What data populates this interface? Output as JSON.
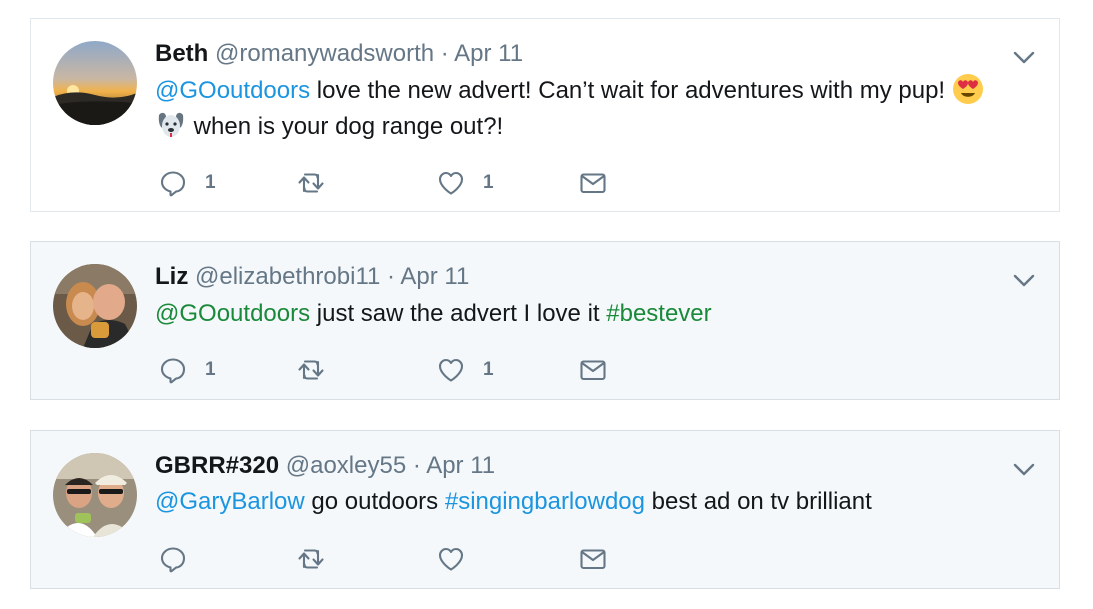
{
  "tweets": [
    {
      "name": "Beth",
      "handle": "@romanywadsworth",
      "dot": "·",
      "date": "Apr 11",
      "line1": {
        "mention": "@GOoutdoors",
        "text": " love the new advert! Can’t wait for adventures with my pup! "
      },
      "line2": {
        "text": " when is your dog range out?!"
      },
      "emojis": [
        "heart-eyes-emoji",
        "dog-face-emoji"
      ],
      "reply_count": "1",
      "retweet_count": "",
      "like_count": "1"
    },
    {
      "name": "Liz",
      "handle": "@elizabethrobi11",
      "dot": "·",
      "date": "Apr 11",
      "line1": {
        "mention": "@GOoutdoors",
        "text": " just saw the advert I love it ",
        "hashtag": "#bestever"
      },
      "reply_count": "1",
      "retweet_count": "",
      "like_count": "1"
    },
    {
      "name": "GBRR#320",
      "handle": "@aoxley55",
      "dot": "·",
      "date": "Apr 11",
      "line1": {
        "mention": "@GaryBarlow",
        "text": " go outdoors ",
        "hashtag": "#singingbarlowdog",
        "text2": " best ad on tv brilliant"
      },
      "reply_count": "",
      "retweet_count": "",
      "like_count": ""
    }
  ],
  "colors": {
    "link": "#1b95e0",
    "link_green": "#1a8a3a",
    "muted": "#657786",
    "highlight_bg": "#f5f8fa"
  }
}
